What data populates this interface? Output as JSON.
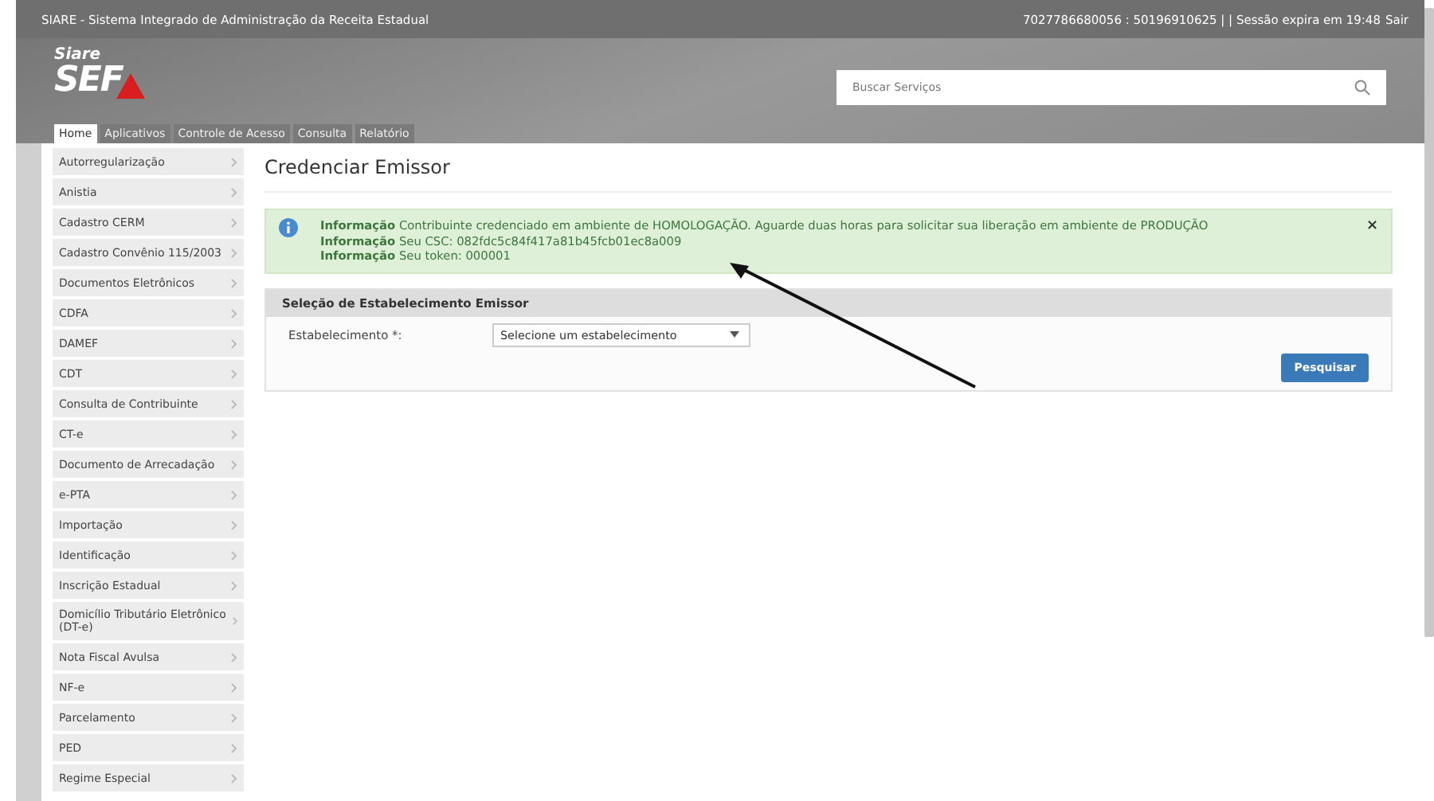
{
  "topbar": {
    "title": "SIARE - Sistema Integrado de Administração da Receita Estadual",
    "session": "7027786680056 : 50196910625 | | Sessão expira em 19:48",
    "logout": "Sair"
  },
  "logo": {
    "small": "Siare",
    "big": "SEF"
  },
  "search": {
    "placeholder": "Buscar Serviços"
  },
  "tabs": [
    {
      "label": "Home",
      "selected": true
    },
    {
      "label": "Aplicativos",
      "selected": false
    },
    {
      "label": "Controle de Acesso",
      "selected": false
    },
    {
      "label": "Consulta",
      "selected": false
    },
    {
      "label": "Relatório",
      "selected": false
    }
  ],
  "sidebar": {
    "items": [
      {
        "label": "Autorregularização"
      },
      {
        "label": "Anistia"
      },
      {
        "label": "Cadastro CERM"
      },
      {
        "label": "Cadastro Convênio 115/2003"
      },
      {
        "label": "Documentos Eletrônicos"
      },
      {
        "label": "CDFA"
      },
      {
        "label": "DAMEF"
      },
      {
        "label": "CDT"
      },
      {
        "label": "Consulta de Contribuinte"
      },
      {
        "label": "CT-e"
      },
      {
        "label": "Documento de Arrecadação"
      },
      {
        "label": "e-PTA"
      },
      {
        "label": "Importação"
      },
      {
        "label": "Identificação"
      },
      {
        "label": "Inscrição Estadual"
      },
      {
        "label": "Domicílio Tributário Eletrônico (DT-e)"
      },
      {
        "label": "Nota Fiscal Avulsa"
      },
      {
        "label": "NF-e"
      },
      {
        "label": "Parcelamento"
      },
      {
        "label": "PED"
      },
      {
        "label": "Regime Especial"
      }
    ]
  },
  "page_title": "Credenciar Emissor",
  "alert": {
    "close": "×",
    "messages": [
      {
        "label": "Informação",
        "text": "Contribuinte credenciado em ambiente de HOMOLOGAÇÃO. Aguarde duas horas para solicitar sua liberação em ambiente de PRODUÇÃO"
      },
      {
        "label": "Informação",
        "text": "Seu CSC: 082fdc5c84f417a81b45fcb01ec8a009"
      },
      {
        "label": "Informação",
        "text": "Seu token: 000001"
      }
    ]
  },
  "panel": {
    "title": "Seleção de Estabelecimento Emissor",
    "field_label": "Estabelecimento *:",
    "select_value": "Selecione um estabelecimento",
    "button": "Pesquisar"
  }
}
